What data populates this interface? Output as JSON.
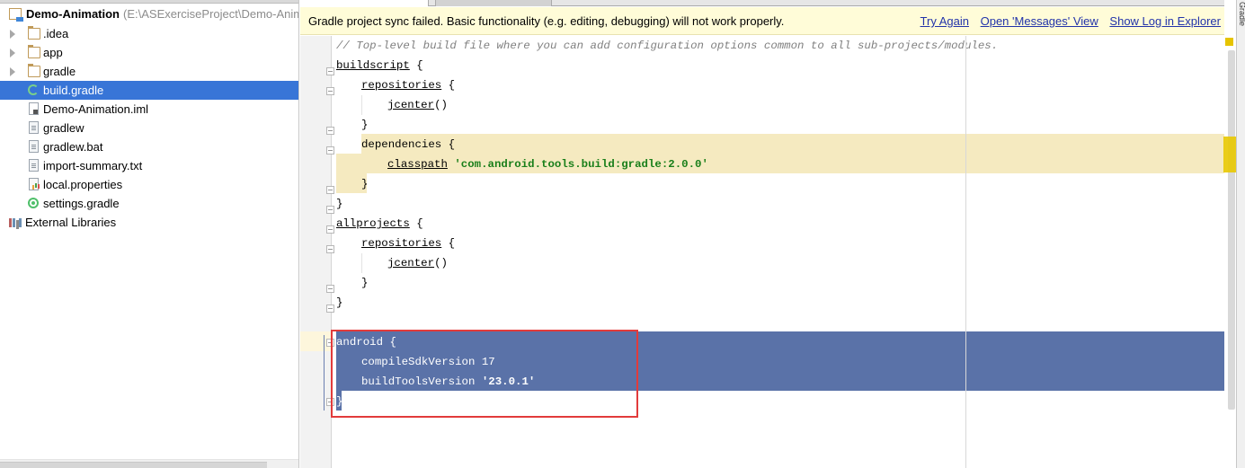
{
  "project": {
    "root_name": "Demo-Animation",
    "root_path": "(E:\\ASExerciseProject\\Demo-Anim",
    "items": [
      {
        "label": ".idea",
        "type": "folder",
        "expandable": true
      },
      {
        "label": "app",
        "type": "folder",
        "expandable": true
      },
      {
        "label": "gradle",
        "type": "folder",
        "expandable": true
      },
      {
        "label": "build.gradle",
        "type": "gradle",
        "selected": true
      },
      {
        "label": "Demo-Animation.iml",
        "type": "iml"
      },
      {
        "label": "gradlew",
        "type": "file"
      },
      {
        "label": "gradlew.bat",
        "type": "file"
      },
      {
        "label": "import-summary.txt",
        "type": "file"
      },
      {
        "label": "local.properties",
        "type": "properties"
      },
      {
        "label": "settings.gradle",
        "type": "gradle-settings"
      }
    ],
    "external_libraries": "External Libraries"
  },
  "notification": {
    "message": "Gradle project sync failed. Basic functionality (e.g. editing, debugging) will not work properly.",
    "links": [
      "Try Again",
      "Open 'Messages' View",
      "Show Log in Explorer"
    ]
  },
  "side_strip_label": "Gradle",
  "code": {
    "comment": "// Top-level build file where you can add configuration options common to all sub-projects/modules.",
    "buildscript": "buildscript",
    "repositories": "repositories",
    "jcenter": "jcenter",
    "dependencies": "dependencies",
    "classpath": "classpath",
    "classpath_value": "'com.android.tools.build:gradle:2.0.0'",
    "allprojects": "allprojects",
    "android": "android",
    "compileSdkVersion_key": "compileSdkVersion",
    "compileSdkVersion_value": "17",
    "buildToolsVersion_key": "buildToolsVersion",
    "buildToolsVersion_value": "'23.0.1'",
    "open_brace": "{",
    "close_brace": "}",
    "parens": "()"
  },
  "colors": {
    "selection": "#5a72a8",
    "tree_selection": "#3875d7",
    "highlight_box": "#e23b3b",
    "notification_bg": "#fffcd8",
    "link": "#2233aa"
  }
}
